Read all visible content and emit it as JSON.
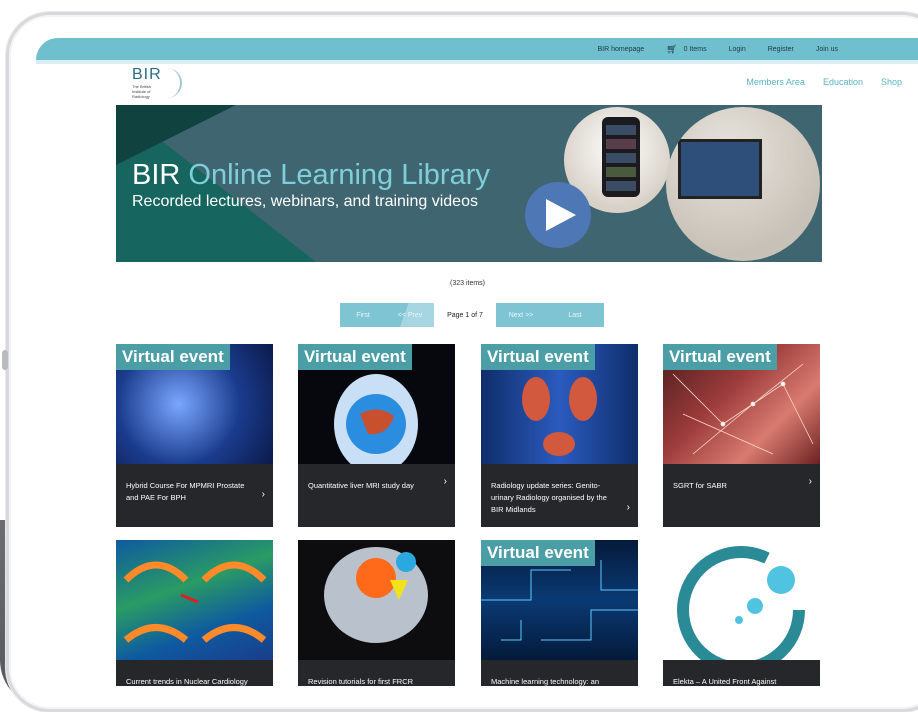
{
  "topbar": {
    "homepage": "BIR homepage",
    "cart": "0 Items",
    "login": "Login",
    "register": "Register",
    "join": "Join us"
  },
  "logo": {
    "abbr": "BIR",
    "sub": "The British Institute of Radiology"
  },
  "nav": {
    "members": "Members Area",
    "education": "Education",
    "shop": "Shop"
  },
  "banner": {
    "title_part1": "BIR ",
    "title_part2": "Online Learning Library",
    "subtitle": "Recorded lectures, webinars, and training videos"
  },
  "listing": {
    "count": "(323  items)",
    "first": "First",
    "prev": "<< Prev",
    "page_of": "Page 1 of 7",
    "next": "Next >>",
    "last": "Last"
  },
  "cards": [
    {
      "badge": "Virtual event",
      "title": "Hybrid Course For MPMRI Prostate and PAE For BPH"
    },
    {
      "badge": "Virtual event",
      "title": "Quantitative liver MRI study day"
    },
    {
      "badge": "Virtual event",
      "title": "Radiology update series: Genito-urinary Radiology organised by the BIR Midlands"
    },
    {
      "badge": "Virtual event",
      "title": "SGRT for SABR"
    },
    {
      "badge": "",
      "title": "Current trends in Nuclear Cardiology"
    },
    {
      "badge": "",
      "title": "Revision tutorials for first FRCR"
    },
    {
      "badge": "Virtual event",
      "title": "Machine learning technology: an"
    },
    {
      "badge": "",
      "title": "Elekta – A United Front Against"
    }
  ],
  "colors": {
    "topbar": "#6fbfcf",
    "accent": "#5ab3c4",
    "badge": "#4b9ea6",
    "card": "#26272b"
  }
}
